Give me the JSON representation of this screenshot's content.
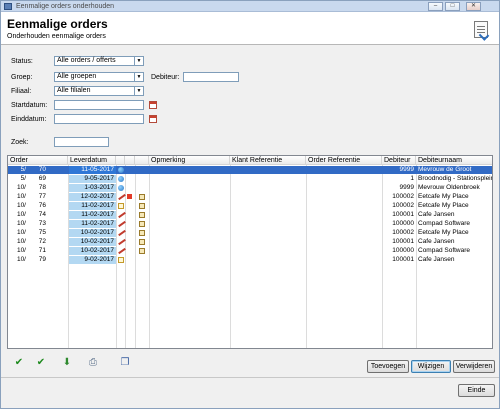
{
  "window": {
    "title": "Eenmalige orders onderhouden",
    "controls": [
      "minimize-icon",
      "maximize-icon",
      "close-icon"
    ]
  },
  "header": {
    "title": "Eenmalige orders",
    "subtitle": "Onderhouden eenmalige orders",
    "icon": "document-check-icon"
  },
  "filters": {
    "status": {
      "label": "Status:",
      "value": "Alle orders / offerts"
    },
    "groep": {
      "label": "Groep:",
      "value": "Alle groepen"
    },
    "debiteur": {
      "label": "Debiteur:",
      "value": ""
    },
    "filiaal": {
      "label": "Filiaal:",
      "value": "Alle filialen"
    },
    "startdatum": {
      "label": "Startdatum:",
      "value": ""
    },
    "einddatum": {
      "label": "Einddatum:",
      "value": ""
    },
    "zoek": {
      "label": "Zoek:",
      "value": ""
    }
  },
  "grid": {
    "columns": [
      "Order",
      "Leverdatum",
      "",
      "",
      "",
      "Opmerking",
      "Klant Referentie",
      "Order Referentie",
      "Debiteur",
      "Debiteurnaam"
    ],
    "rows": [
      {
        "order_a": "5/",
        "order_b": "70",
        "leverdatum": "11-05-2017",
        "icon1": "globe",
        "icon2": "",
        "icon3": "",
        "debiteur": "9999",
        "debiteurnaam": "Mevrouw de Groot",
        "selected": true
      },
      {
        "order_a": "5/",
        "order_b": "69",
        "leverdatum": "9-05-2017",
        "icon1": "globe",
        "icon2": "",
        "icon3": "",
        "debiteur": "1",
        "debiteurnaam": "Broodnodig - Stationsplein",
        "selected": false
      },
      {
        "order_a": "10/",
        "order_b": "78",
        "leverdatum": "1-03-2017",
        "icon1": "globe",
        "icon2": "",
        "icon3": "",
        "debiteur": "9999",
        "debiteurnaam": "Mevrouw Oldenbroek",
        "selected": false
      },
      {
        "order_a": "10/",
        "order_b": "77",
        "leverdatum": "12-02-2017",
        "icon1": "pen",
        "icon2": "flag",
        "icon3": "sheet",
        "debiteur": "100002",
        "debiteurnaam": "Eetcafe My Place",
        "selected": false
      },
      {
        "order_a": "10/",
        "order_b": "76",
        "leverdatum": "11-02-2017",
        "icon1": "doc",
        "icon2": "",
        "icon3": "sheet",
        "debiteur": "100002",
        "debiteurnaam": "Eetcafe My Place",
        "selected": false
      },
      {
        "order_a": "10/",
        "order_b": "74",
        "leverdatum": "11-02-2017",
        "icon1": "pen",
        "icon2": "",
        "icon3": "sheet",
        "debiteur": "100001",
        "debiteurnaam": "Cafe Jansen",
        "selected": false
      },
      {
        "order_a": "10/",
        "order_b": "73",
        "leverdatum": "11-02-2017",
        "icon1": "pen",
        "icon2": "",
        "icon3": "sheet",
        "debiteur": "100000",
        "debiteurnaam": "Compad Software",
        "selected": false
      },
      {
        "order_a": "10/",
        "order_b": "75",
        "leverdatum": "10-02-2017",
        "icon1": "pen",
        "icon2": "",
        "icon3": "sheet",
        "debiteur": "100002",
        "debiteurnaam": "Eetcafe My Place",
        "selected": false
      },
      {
        "order_a": "10/",
        "order_b": "72",
        "leverdatum": "10-02-2017",
        "icon1": "pen",
        "icon2": "",
        "icon3": "sheet",
        "debiteur": "100001",
        "debiteurnaam": "Cafe Jansen",
        "selected": false
      },
      {
        "order_a": "10/",
        "order_b": "71",
        "leverdatum": "10-02-2017",
        "icon1": "pen",
        "icon2": "",
        "icon3": "sheet",
        "debiteur": "100000",
        "debiteurnaam": "Compad Software",
        "selected": false
      },
      {
        "order_a": "10/",
        "order_b": "79",
        "leverdatum": "9-02-2017",
        "icon1": "doc",
        "icon2": "",
        "icon3": "",
        "debiteur": "100001",
        "debiteurnaam": "Cafe Jansen",
        "selected": false
      }
    ]
  },
  "toolbar": {
    "icons": [
      "check-icon",
      "check-all-icon",
      "export-icon",
      "print-icon",
      "copy-icon"
    ]
  },
  "buttons": {
    "toevoegen": "Toevoegen",
    "wijzigen": "Wijzigen",
    "verwijderen": "Verwijderen",
    "einde": "Einde"
  }
}
